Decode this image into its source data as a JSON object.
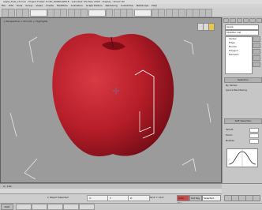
{
  "app": {
    "title": "apple_final_v3.max   -   Project Folder: E:\\3D_WORK\\APPLE   -   Autodesk 3ds Max 2009  -  Display : Direct 3D"
  },
  "menubar": {
    "items": [
      "File",
      "Edit",
      "Tools",
      "Group",
      "Views",
      "Create",
      "Modifiers",
      "Animation",
      "Graph Editors",
      "Rendering",
      "Customize",
      "MAXScript",
      "Help"
    ]
  },
  "viewport": {
    "label": "+ Perspective + Smooth + Highlights",
    "colors": {
      "background": "#9b9b9b",
      "apple": "#c2202b",
      "apple_dark": "#7c0e18",
      "gizmo": "#f2f2f2"
    }
  },
  "command_panel": {
    "object_name": "Apple",
    "modifier_list_placeholder": "Modifier List",
    "stack_items": [
      "Vertex",
      "Edge",
      "Border",
      "Polygon",
      "Element"
    ],
    "sections": [
      "Selection",
      "Soft Selection"
    ],
    "rows": [
      {
        "label": "By Vertex"
      },
      {
        "label": "Ignore Backfacing"
      },
      {
        "label": "Falloff:"
      },
      {
        "label": "Pinch:"
      },
      {
        "label": "Bubble:"
      }
    ]
  },
  "timeline": {
    "current_frame": "0 / 100"
  },
  "statusbar": {
    "selection": "1 Object Selected",
    "coords": {
      "x": "X:",
      "y": "Y:",
      "z": "Z:"
    },
    "grid": "Grid = 10.0",
    "auto_key": "Auto Key",
    "set_key": "Set Key",
    "selected": "Selected"
  },
  "taskbar": {
    "start_label": "start"
  }
}
